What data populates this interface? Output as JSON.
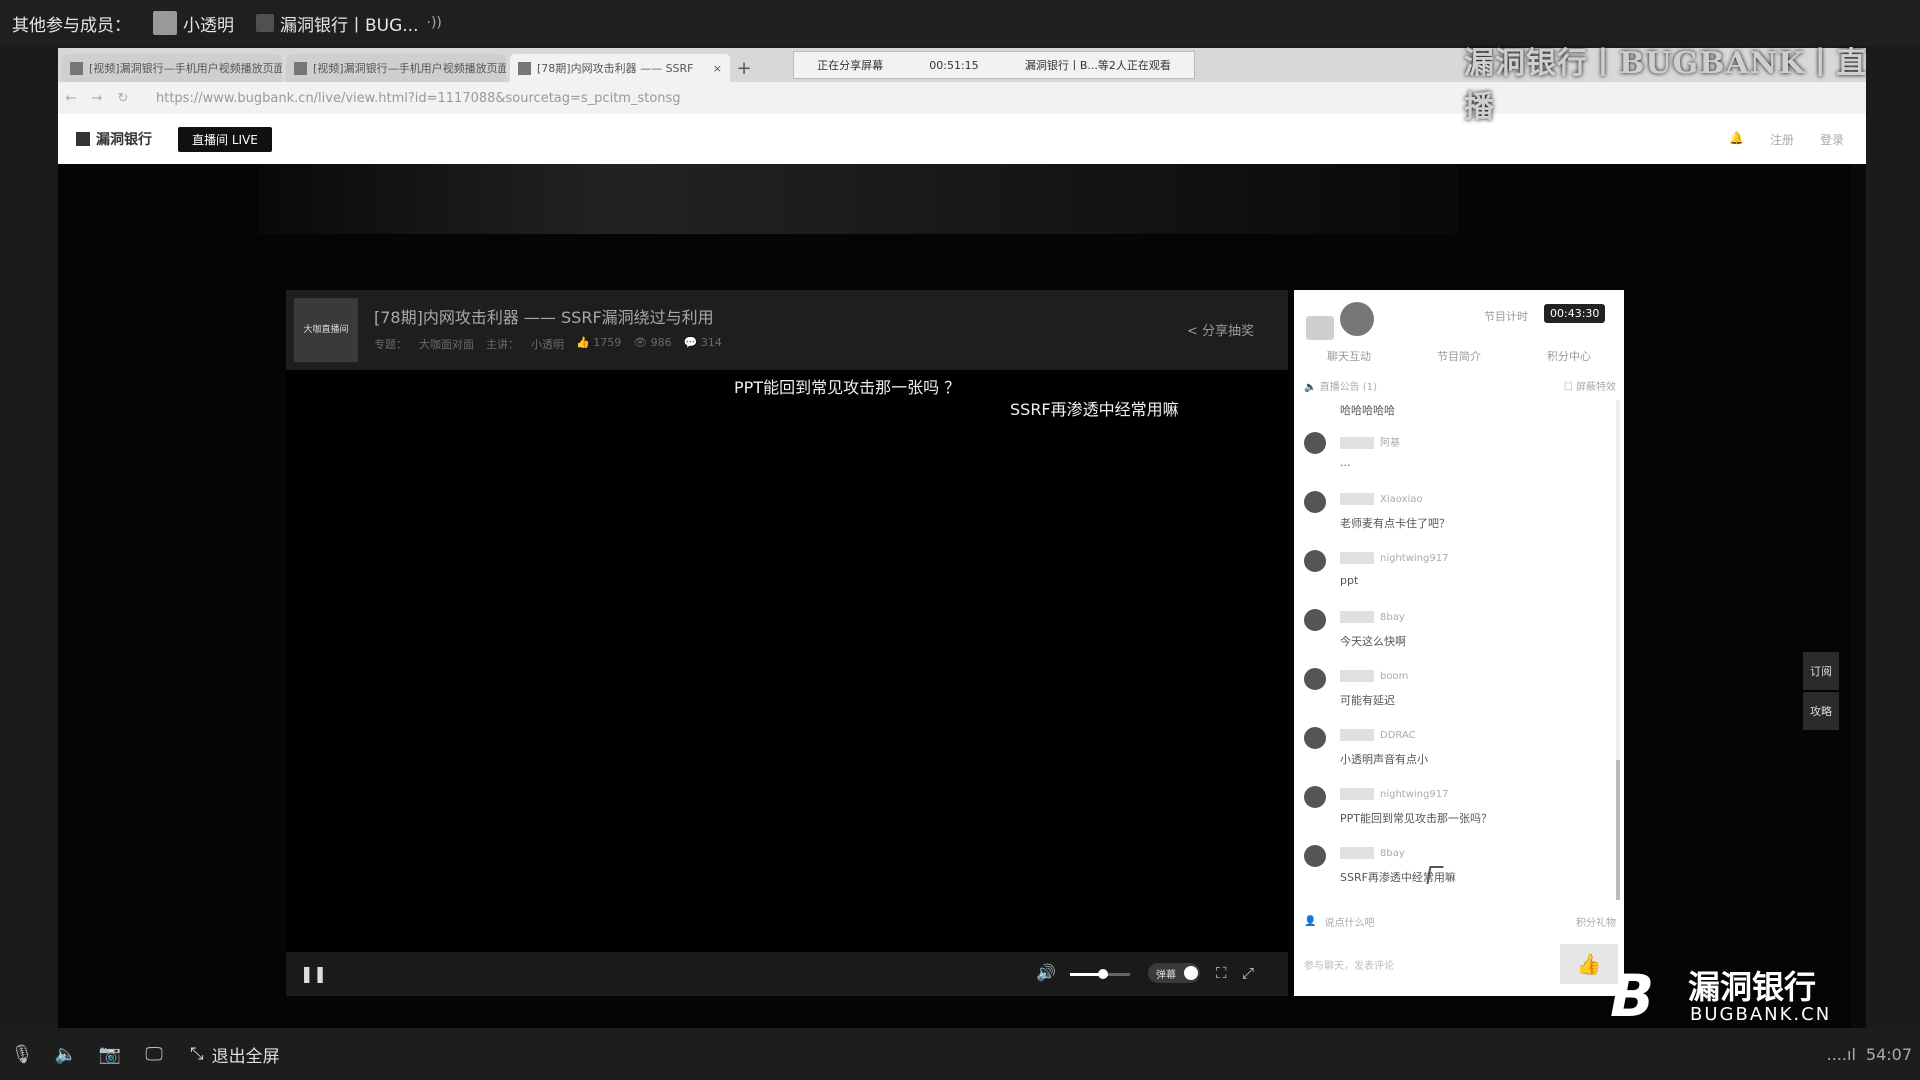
{
  "members_bar": {
    "label": "其他参与成员：",
    "members": [
      {
        "name": "小透明",
        "speaker": ""
      },
      {
        "name": "漏洞银行丨BUG...",
        "speaker": "·))"
      }
    ]
  },
  "browser": {
    "tabs": [
      {
        "title": "[视频]漏洞银行—手机用户视频播放页面",
        "active": false,
        "close": "×"
      },
      {
        "title": "[视频]漏洞银行—手机用户视频播放页面",
        "active": false,
        "close": "×"
      },
      {
        "title": "[78期]内网攻击利器 —— SSRF",
        "active": true,
        "close": "×"
      }
    ],
    "new_tab": "+",
    "share_status": {
      "text": "正在分享屏幕",
      "time": "00:51:15",
      "watchers": "漏洞银行丨B...等2人正在观看"
    },
    "nav": {
      "back": "←",
      "forward": "→",
      "reload": "↻"
    },
    "url": "https://www.bugbank.cn/live/view.html?id=1117088&sourcetag=s_pcitm_stonsg"
  },
  "site_header": {
    "logo_text": "漏洞银行",
    "live_badge": "直播间 LIVE",
    "right_links": [
      "🔔",
      "注册",
      "登录"
    ]
  },
  "player": {
    "thumbnail_text": "大咖直播间",
    "title": "[78期]内网攻击利器 —— SSRF漏洞绕过与利用",
    "meta": [
      "专题：",
      "大咖面对面",
      "主讲：",
      "小透明",
      "👍 1759",
      "👁 986",
      "💬 314"
    ],
    "share_label": "分享抽奖",
    "subtitles": [
      "PPT能回到常见攻击那一张吗 ？",
      "SSRF再渗透中经常用嘛"
    ],
    "controls": {
      "pause": "❚❚",
      "volume": "🔊",
      "volume_level": 0.56,
      "danmu_label": "弹幕",
      "fullscreen_icon": "⛶",
      "expand_icon": "⤢"
    }
  },
  "chat": {
    "timer_label": "节目计时",
    "timer_value": "00:43:30",
    "tabs": [
      "聊天互动",
      "节目简介",
      "积分中心"
    ],
    "notice_left": "🔈 直播公告 (1)",
    "notice_right": "☐ 屏蔽特效",
    "first_message": "哈哈哈哈哈",
    "messages": [
      {
        "name": "阿基",
        "text": "..."
      },
      {
        "name": "Xiaoxiao",
        "text": "老师麦有点卡住了吧？"
      },
      {
        "name": "nightwing917",
        "text": "ppt"
      },
      {
        "name": "8bay",
        "text": "今天这么快啊"
      },
      {
        "name": "boom",
        "text": "可能有延迟"
      },
      {
        "name": "DDRAC",
        "text": "小透明声音有点小"
      },
      {
        "name": "nightwing917",
        "text": "PPT能回到常见攻击那一张吗？"
      },
      {
        "name": "8bay",
        "text": "SSRF再渗透中经常用嘛"
      }
    ],
    "input_placeholder": "说点什么吧",
    "input_right": "积分礼物",
    "bottom_text": "参与聊天，发表评论",
    "like_icon": "👍"
  },
  "watermark_text": "漏洞银行丨BUGBANK丨直播",
  "side_buttons": [
    "订阅",
    "攻略"
  ],
  "brand": {
    "mark": "B",
    "cn": "漏洞银行",
    "en": "BUGBANK.CN"
  },
  "bottom_bar": {
    "icons": [
      "🎙",
      "🔈",
      "📷",
      "🖵"
    ],
    "exit_fullscreen": "退出全屏",
    "signal": "....ıl",
    "time": "54:07"
  }
}
